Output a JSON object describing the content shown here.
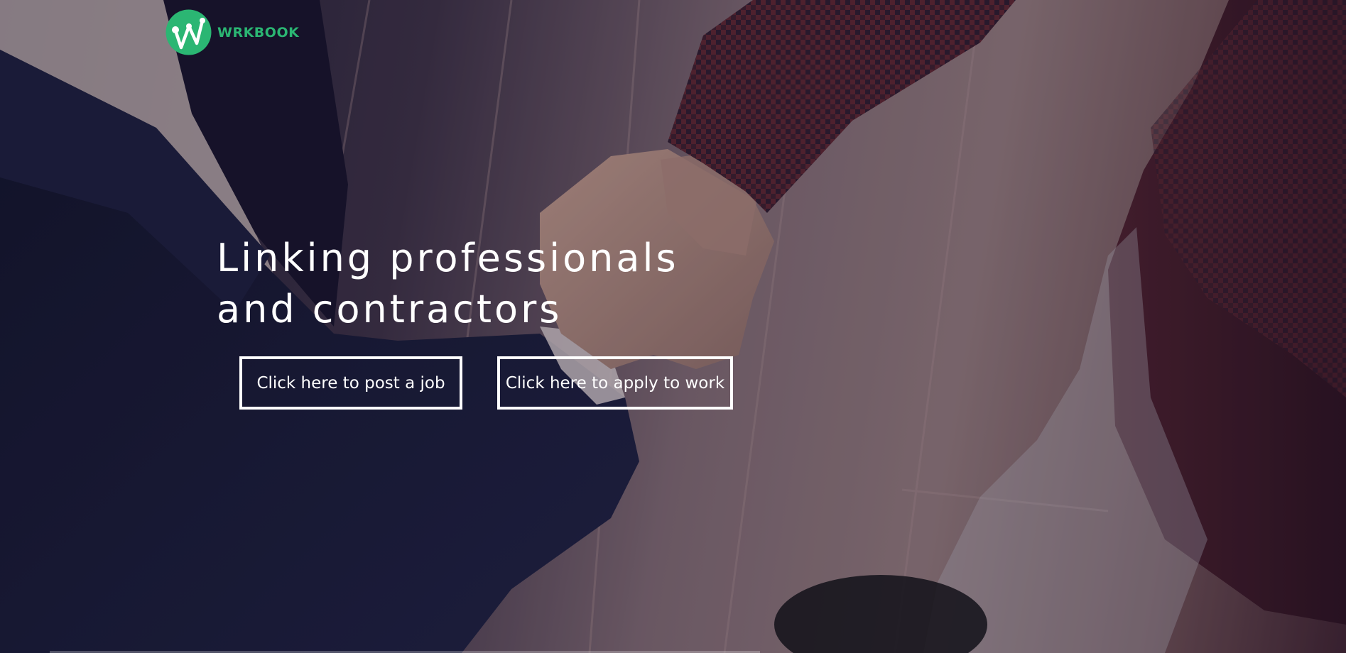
{
  "brand": {
    "name": "WRKBOOK",
    "color": "#2bb673"
  },
  "hero": {
    "headline_line1": "Linking professionals",
    "headline_line2": "and contractors",
    "background_icon": "handshake-photo"
  },
  "actions": {
    "post_job_label": "Click here to post a job",
    "apply_work_label": "Click here to apply to work"
  },
  "colors": {
    "text": "#ffffff",
    "accent": "#2bb673"
  }
}
